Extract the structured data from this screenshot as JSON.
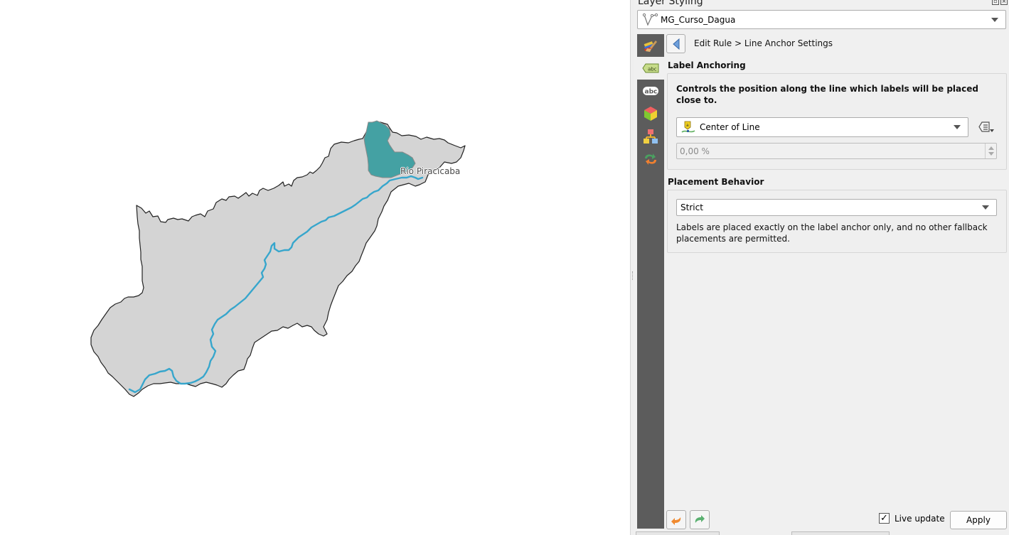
{
  "map": {
    "river_label": "Rio Piracicaba",
    "colors": {
      "basin_fill": "#d4d4d4",
      "basin_stroke": "#222222",
      "sub_basin_fill": "#44a1a3",
      "river": "#37a6cc"
    }
  },
  "panel": {
    "title": "Layer Styling",
    "layer_combo": {
      "icon": "line-layer-icon",
      "value": "MG_Curso_Dagua"
    },
    "sidebar": [
      {
        "icon": "symbology-paintbrush-icon",
        "label": "Symbology"
      },
      {
        "icon": "labels-icon",
        "label": "Labels"
      },
      {
        "icon": "masks-icon",
        "label": "Masks"
      },
      {
        "icon": "3d-view-icon",
        "label": "3D View"
      },
      {
        "icon": "diagrams-icon",
        "label": "Diagrams"
      },
      {
        "icon": "history-icon",
        "label": "History"
      }
    ],
    "breadcrumb": "Edit Rule > Line Anchor Settings",
    "label_anchoring": {
      "title": "Label Anchoring",
      "description": "Controls the position along the line which labels will be placed close to.",
      "anchor_combo": {
        "icon": "center-of-line-icon",
        "value": "Center of Line"
      },
      "percent_spin": {
        "value": "0,00 %",
        "enabled": false
      }
    },
    "placement_behavior": {
      "title": "Placement Behavior",
      "combo_value": "Strict",
      "description": "Labels are placed exactly on the label anchor only, and no other fallback placements are permitted."
    },
    "footer": {
      "undo_icon": "undo-icon",
      "redo_icon": "redo-icon",
      "live_update_label": "Live update",
      "live_update_checked": true,
      "apply_label": "Apply"
    }
  }
}
